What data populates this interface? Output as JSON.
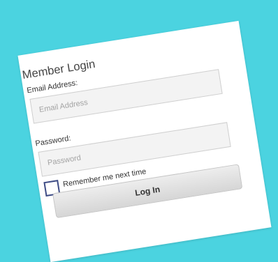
{
  "page": {
    "background_color": "#4bd3e0"
  },
  "login_form": {
    "title": "Member Login",
    "email": {
      "label": "Email Address:",
      "placeholder": "Email Address",
      "value": ""
    },
    "password": {
      "label": "Password:",
      "placeholder": "Password",
      "value": ""
    },
    "remember_me": {
      "label": "Remember me next time",
      "checked": false
    },
    "submit_label": "Log In"
  }
}
